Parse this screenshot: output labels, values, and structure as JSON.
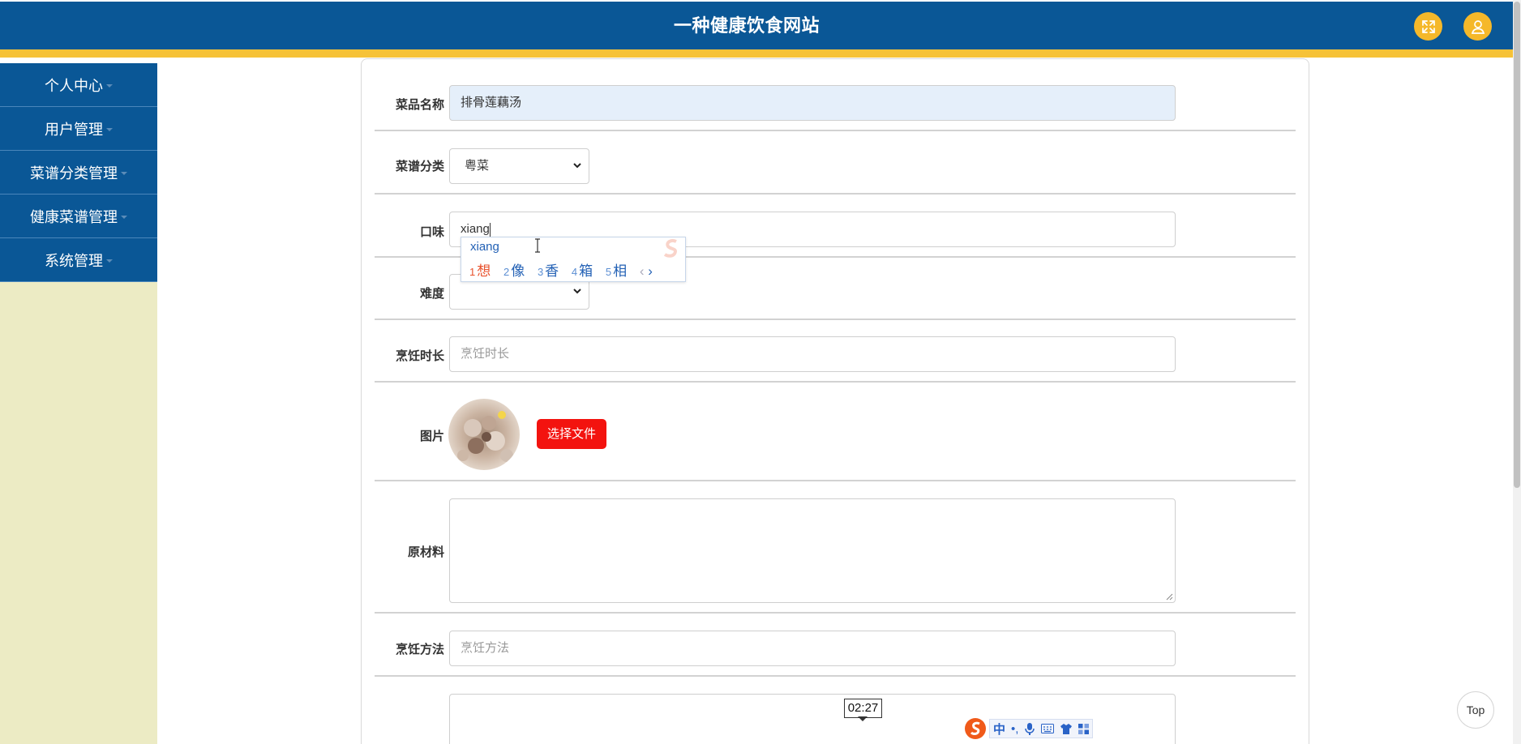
{
  "header": {
    "title": "一种健康饮食网站"
  },
  "colors": {
    "primary": "#0a5796",
    "accent": "#f6c237",
    "sidebar_bg": "#ecebc4",
    "danger": "#f3130f"
  },
  "sidebar": {
    "items": [
      {
        "label": "个人中心"
      },
      {
        "label": "用户管理"
      },
      {
        "label": "菜谱分类管理"
      },
      {
        "label": "健康菜谱管理"
      },
      {
        "label": "系统管理"
      }
    ]
  },
  "form": {
    "name": {
      "label": "菜品名称",
      "value": "排骨莲藕汤"
    },
    "category": {
      "label": "菜谱分类",
      "value": "粤菜"
    },
    "taste": {
      "label": "口味",
      "value": "xiang"
    },
    "difficulty": {
      "label": "难度",
      "value": ""
    },
    "cook_time": {
      "label": "烹饪时长",
      "placeholder": "烹饪时长"
    },
    "image": {
      "label": "图片",
      "button": "选择文件"
    },
    "ingredients": {
      "label": "原材料"
    },
    "method": {
      "label": "烹饪方法",
      "placeholder": "烹饪方法"
    }
  },
  "ime": {
    "composition": "xiang",
    "candidates": [
      {
        "num": "1",
        "text": "想"
      },
      {
        "num": "2",
        "text": "像"
      },
      {
        "num": "3",
        "text": "香"
      },
      {
        "num": "4",
        "text": "箱"
      },
      {
        "num": "5",
        "text": "相"
      }
    ],
    "toolbar_lang": "中"
  },
  "timer": "02:27",
  "top_button": "Top",
  "icons": [
    "fullscreen-icon",
    "user-icon",
    "chevron-down-icon",
    "sogou-logo-icon",
    "text-cursor-icon",
    "resize-handle-icon"
  ]
}
